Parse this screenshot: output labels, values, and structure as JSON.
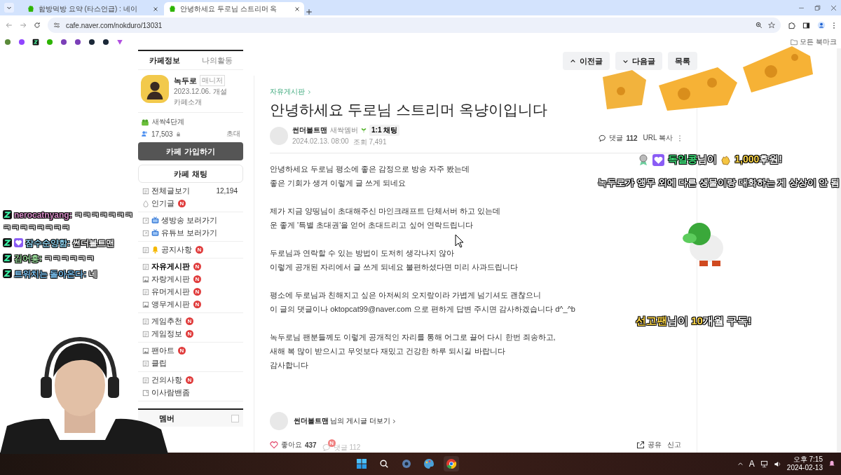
{
  "browser": {
    "tabs": [
      {
        "title": "함방먹방 요약 (타스언급) : 네이",
        "selected": false
      },
      {
        "title": "안녕하세요 두로님 스트리머 옥",
        "selected": true
      }
    ],
    "url": "cafe.naver.com/nokduro/13031",
    "bookmarks_folder": "모든 북마크"
  },
  "post_nav": [
    {
      "label": "이전글",
      "kind": "up"
    },
    {
      "label": "다음글",
      "kind": "down"
    },
    {
      "label": "목록",
      "kind": "plain"
    }
  ],
  "sidebar": {
    "tabs": [
      {
        "label": "카페정보",
        "selected": true
      },
      {
        "label": "나의활동",
        "selected": false
      }
    ],
    "cafe_name": "녹두로",
    "role": "매니저",
    "founded": "2023.12.06. 개설",
    "intro_link": "카페소개",
    "level": "새싹4단계",
    "members": "17,503",
    "invite": "초대",
    "join_button": "카페 가입하기",
    "chat_button": "카페 채팅",
    "menu_groups": [
      [
        {
          "label": "전체글보기",
          "kind": "board",
          "count": "12,194",
          "selected": false
        },
        {
          "label": "인기글",
          "kind": "popular",
          "badge": "N",
          "selected": false
        }
      ],
      [
        {
          "label": "생방송 보러가기",
          "kind": "link-tv",
          "selected": false
        },
        {
          "label": "유튜브 보러가기",
          "kind": "link-tv",
          "selected": false
        }
      ],
      [
        {
          "label": "공지사항",
          "kind": "board-bell",
          "badge": "N",
          "selected": false
        }
      ],
      [
        {
          "label": "자유게시판",
          "kind": "board",
          "badge": "N",
          "selected": true
        },
        {
          "label": "자랑게시판",
          "kind": "gallery",
          "badge": "N",
          "selected": false
        },
        {
          "label": "유머게시판",
          "kind": "board",
          "badge": "N",
          "selected": false
        },
        {
          "label": "앵무게시판",
          "kind": "gallery",
          "badge": "N",
          "selected": false
        }
      ],
      [
        {
          "label": "게임추천",
          "kind": "board",
          "badge": "N",
          "selected": false
        },
        {
          "label": "게임정보",
          "kind": "board",
          "badge": "N",
          "selected": false
        }
      ],
      [
        {
          "label": "팬아트",
          "kind": "gallery",
          "badge": "N",
          "selected": false
        },
        {
          "label": "클립",
          "kind": "board",
          "selected": false
        }
      ],
      [
        {
          "label": "건의사항",
          "kind": "board",
          "badge": "N",
          "selected": false
        },
        {
          "label": "이사람밴좀",
          "kind": "memo",
          "selected": false
        }
      ]
    ],
    "member_section": "멤버"
  },
  "post": {
    "board": "자유게시판",
    "title": "안녕하세요 두로님 스트리머 옥냥이입니다",
    "author": "썬더볼트맨",
    "rank": "새싹멤버",
    "chat": "1:1 채팅",
    "date": "2024.02.13. 08:00",
    "views": "조회 7,491",
    "comments_label": "댓글",
    "comments_count": "112",
    "url_copy": "URL 복사",
    "paragraphs": [
      [
        "안녕하세요 두로님 평소에 좋은 감정으로 방송 자주 봤는데",
        "좋은 기회가 생겨 이렇게 글 쓰게 되네요"
      ],
      [
        "제가 지금 양띵님이 초대해주신 마인크래프트 단체서버 하고 있는데",
        "운 좋게 '특별 초대권'을 얻어 초대드리고 싶어 연락드립니다"
      ],
      [
        "두로님과 연락할 수 있는 방법이 도저히 생각나지 않아",
        "이렇게 공개된 자리에서 글 쓰게 되네요 불편하셨다면 미리 사과드립니다"
      ],
      [
        "평소에 두로님과 친해지고 싶은 아저씨의 오지랖이라 가볍게 넘기셔도 괜찮으니",
        "이 글의 댓글이나 oktopcat99@naver.com 으로 편하게 답변 주시면 감사하겠습니다 d^_^b"
      ],
      [
        "녹두로님 팬분들께도 이렇게 공개적인 자리를 통해 어그로 끌어 다시 한번 죄송하고,",
        "새해 복 많이 받으시고 무엇보다 재밌고 건강한 하루 되시길 바랍니다",
        "감사합니다"
      ]
    ],
    "more_author": "썬더볼트맨",
    "more_suffix": "님의 게시글 더보기",
    "like_label": "좋아요",
    "like_count": "437",
    "comment_badge": "N",
    "footer_comments_label": "댓글",
    "footer_comments_count": "112",
    "share": "공유",
    "report": "신고"
  },
  "chat": [
    {
      "user": "nerocatnyang:",
      "color": "#d58cc6",
      "subscriber": false,
      "text": "ㅋㅋㅋㅋㅋㅋㅋㅋㅋㅋㅋㅋㅋㅋㅋ"
    },
    {
      "user": "잠수순양함:",
      "color": "#8fd3f0",
      "subscriber": true,
      "text": "썬더볼트맨"
    },
    {
      "user": "김어흥:",
      "color": "#9ad89a",
      "subscriber": false,
      "text": "ㅋㅋㅋㅋㅋㅋ"
    },
    {
      "user": "트위치는 돌아온다:",
      "color": "#7cc4f4",
      "subscriber": false,
      "text": "네"
    }
  ],
  "donation": {
    "name": "독일콩",
    "suffix": "님이",
    "amount": "1,000",
    "action": "후원!",
    "message": "녹두로가 앵무 외에 다른 생물이랑 대화하는 게 상상이 안 됨"
  },
  "subscription": {
    "name": "선고팬",
    "suffix": "님이",
    "months": "10",
    "action": "개월 구독!"
  },
  "taskbar": {
    "ime": "A",
    "time": "오후 7:15",
    "date": "2024-02-13"
  }
}
